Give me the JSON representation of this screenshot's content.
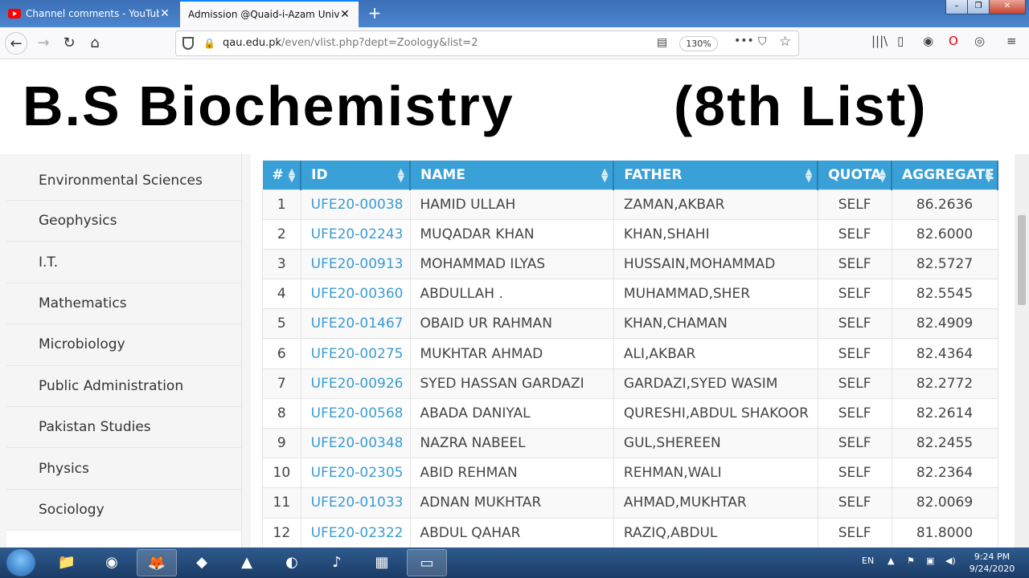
{
  "browser": {
    "tabs": [
      {
        "title": "Channel comments - YouTube",
        "active": false
      },
      {
        "title": "Admission @Quaid-i-Azam Univers",
        "active": true
      }
    ],
    "new_tab": "+",
    "url_domain": "qau.edu.pk",
    "url_path": "/even/vlist.php?dept=Zoology&list=2",
    "zoom": "130%"
  },
  "banner": {
    "title": "B.S Biochemistry",
    "subtitle": "(8th List)"
  },
  "sidebar": {
    "items": [
      "Environmental Sciences",
      "Geophysics",
      "I.T.",
      "Mathematics",
      "Microbiology",
      "Public Administration",
      "Pakistan Studies",
      "Physics",
      "Sociology"
    ]
  },
  "table": {
    "headers": [
      "#",
      "ID",
      "NAME",
      "FATHER",
      "QUOTA",
      "AGGREGATE"
    ],
    "rows": [
      [
        "1",
        "UFE20-00038",
        "HAMID ULLAH",
        "ZAMAN,AKBAR",
        "SELF",
        "86.2636"
      ],
      [
        "2",
        "UFE20-02243",
        "MUQADAR KHAN",
        "KHAN,SHAHI",
        "SELF",
        "82.6000"
      ],
      [
        "3",
        "UFE20-00913",
        "MOHAMMAD ILYAS",
        "HUSSAIN,MOHAMMAD",
        "SELF",
        "82.5727"
      ],
      [
        "4",
        "UFE20-00360",
        "ABDULLAH .",
        "MUHAMMAD,SHER",
        "SELF",
        "82.5545"
      ],
      [
        "5",
        "UFE20-01467",
        "OBAID UR RAHMAN",
        "KHAN,CHAMAN",
        "SELF",
        "82.4909"
      ],
      [
        "6",
        "UFE20-00275",
        "MUKHTAR AHMAD",
        "ALI,AKBAR",
        "SELF",
        "82.4364"
      ],
      [
        "7",
        "UFE20-00926",
        "SYED HASSAN GARDAZI",
        "GARDAZI,SYED WASIM",
        "SELF",
        "82.2772"
      ],
      [
        "8",
        "UFE20-00568",
        "ABADA DANIYAL",
        "QURESHI,ABDUL SHAKOOR",
        "SELF",
        "82.2614"
      ],
      [
        "9",
        "UFE20-00348",
        "NAZRA NABEEL",
        "GUL,SHEREEN",
        "SELF",
        "82.2455"
      ],
      [
        "10",
        "UFE20-02305",
        "ABID REHMAN",
        "REHMAN,WALI",
        "SELF",
        "82.2364"
      ],
      [
        "11",
        "UFE20-01033",
        "ADNAN MUKHTAR",
        "AHMAD,MUKHTAR",
        "SELF",
        "82.0069"
      ],
      [
        "12",
        "UFE20-02322",
        "ABDUL QAHAR",
        "RAZIQ,ABDUL",
        "SELF",
        "81.8000"
      ]
    ]
  },
  "taskbar": {
    "language": "EN",
    "time": "9:24 PM",
    "date": "9/24/2020"
  },
  "colors": {
    "header_blue": "#3aa0d8",
    "id_link": "#3a9bd2"
  }
}
